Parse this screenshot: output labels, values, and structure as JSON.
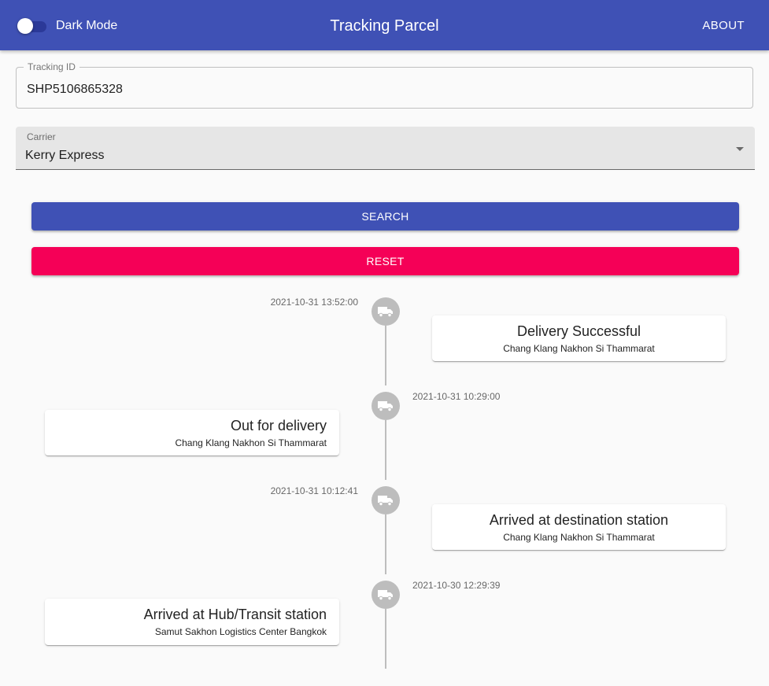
{
  "appbar": {
    "dark_mode_label": "Dark Mode",
    "title": "Tracking Parcel",
    "about_label": "ABOUT"
  },
  "form": {
    "tracking_id": {
      "label": "Tracking ID",
      "value": "SHP5106865328"
    },
    "carrier": {
      "label": "Carrier",
      "value": "Kerry Express"
    },
    "search_label": "SEARCH",
    "reset_label": "RESET"
  },
  "timeline": [
    {
      "time": "2021-10-31 13:52:00",
      "status": "Delivery Successful",
      "location": "Chang Klang Nakhon Si Thammarat"
    },
    {
      "time": "2021-10-31 10:29:00",
      "status": "Out for delivery",
      "location": "Chang Klang Nakhon Si Thammarat"
    },
    {
      "time": "2021-10-31 10:12:41",
      "status": "Arrived at destination station",
      "location": "Chang Klang Nakhon Si Thammarat"
    },
    {
      "time": "2021-10-30 12:29:39",
      "status": "Arrived at Hub/Transit station",
      "location": "Samut Sakhon Logistics Center Bangkok"
    }
  ],
  "colors": {
    "primary": "#3f51b5",
    "secondary": "#f50057",
    "timeline_dot": "#bdbdbd",
    "background": "#fafafa"
  },
  "icons": {
    "timeline_icon": "truck-icon"
  }
}
